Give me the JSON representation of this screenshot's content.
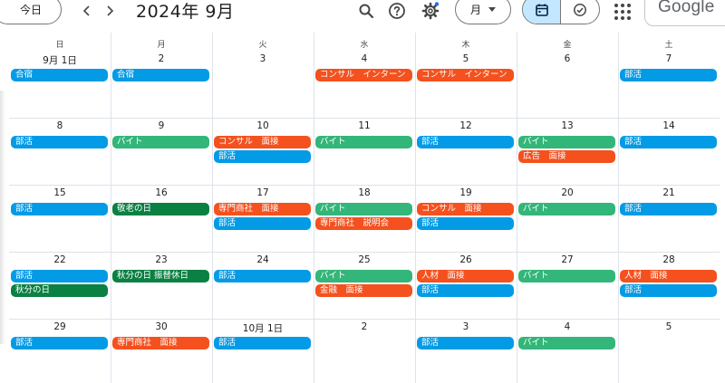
{
  "header": {
    "today_label": "今日",
    "month_title": "2024年 9月",
    "view_label": "月",
    "logo_text": "Google"
  },
  "colors": {
    "blue": "#039be5",
    "green": "#33b679",
    "dark_green": "#0b8043",
    "orange": "#f4511e",
    "selected_segment": "#c2e7ff",
    "notification_dot": "#1a73e8"
  },
  "icons": [
    "chevron-left-icon",
    "chevron-right-icon",
    "search-icon",
    "help-icon",
    "gear-icon",
    "calendar-icon",
    "task-check-icon",
    "apps-grid-icon"
  ],
  "weekdays": [
    "日",
    "月",
    "火",
    "水",
    "木",
    "金",
    "土"
  ],
  "weeks": [
    {
      "dates": [
        "9月 1日",
        "2",
        "3",
        "4",
        "5",
        "6",
        "7"
      ],
      "events": [
        {
          "day": 0,
          "row": 0,
          "text": "合宿",
          "color": "blue"
        },
        {
          "day": 1,
          "row": 0,
          "text": "合宿",
          "color": "blue"
        },
        {
          "day": 3,
          "row": 0,
          "text": "コンサル　インターン",
          "color": "orange"
        },
        {
          "day": 4,
          "row": 0,
          "text": "コンサル　インターン",
          "color": "orange"
        },
        {
          "day": 6,
          "row": 0,
          "text": "部活",
          "color": "blue"
        }
      ]
    },
    {
      "dates": [
        "8",
        "9",
        "10",
        "11",
        "12",
        "13",
        "14"
      ],
      "events": [
        {
          "day": 0,
          "row": 0,
          "text": "部活",
          "color": "blue"
        },
        {
          "day": 1,
          "row": 0,
          "text": "バイト",
          "color": "green"
        },
        {
          "day": 2,
          "row": 0,
          "text": "コンサル　面接",
          "color": "orange"
        },
        {
          "day": 2,
          "row": 1,
          "text": "部活",
          "color": "blue"
        },
        {
          "day": 3,
          "row": 0,
          "text": "バイト",
          "color": "green"
        },
        {
          "day": 4,
          "row": 0,
          "text": "部活",
          "color": "blue"
        },
        {
          "day": 5,
          "row": 0,
          "text": "バイト",
          "color": "green"
        },
        {
          "day": 5,
          "row": 1,
          "text": "広告　面接",
          "color": "orange"
        },
        {
          "day": 6,
          "row": 0,
          "text": "部活",
          "color": "blue"
        }
      ]
    },
    {
      "dates": [
        "15",
        "16",
        "17",
        "18",
        "19",
        "20",
        "21"
      ],
      "events": [
        {
          "day": 0,
          "row": 0,
          "text": "部活",
          "color": "blue"
        },
        {
          "day": 1,
          "row": 0,
          "text": "敬老の日",
          "color": "dark_green"
        },
        {
          "day": 2,
          "row": 0,
          "text": "専門商社　面接",
          "color": "orange"
        },
        {
          "day": 2,
          "row": 1,
          "text": "部活",
          "color": "blue"
        },
        {
          "day": 3,
          "row": 0,
          "text": "バイト",
          "color": "green"
        },
        {
          "day": 3,
          "row": 1,
          "text": "専門商社　説明会",
          "color": "orange"
        },
        {
          "day": 4,
          "row": 0,
          "text": "コンサル　面接",
          "color": "orange"
        },
        {
          "day": 4,
          "row": 1,
          "text": "部活",
          "color": "blue"
        },
        {
          "day": 5,
          "row": 0,
          "text": "バイト",
          "color": "green"
        },
        {
          "day": 6,
          "row": 0,
          "text": "部活",
          "color": "blue"
        }
      ]
    },
    {
      "dates": [
        "22",
        "23",
        "24",
        "25",
        "26",
        "27",
        "28"
      ],
      "events": [
        {
          "day": 0,
          "row": 0,
          "text": "部活",
          "color": "blue"
        },
        {
          "day": 0,
          "row": 1,
          "text": "秋分の日",
          "color": "dark_green"
        },
        {
          "day": 1,
          "row": 0,
          "text": "秋分の日 振替休日",
          "color": "dark_green"
        },
        {
          "day": 2,
          "row": 0,
          "text": "部活",
          "color": "blue"
        },
        {
          "day": 3,
          "row": 0,
          "text": "バイト",
          "color": "green"
        },
        {
          "day": 3,
          "row": 1,
          "text": "金融　面接",
          "color": "orange"
        },
        {
          "day": 4,
          "row": 0,
          "text": "人材　面接",
          "color": "orange"
        },
        {
          "day": 4,
          "row": 1,
          "text": "部活",
          "color": "blue"
        },
        {
          "day": 5,
          "row": 0,
          "text": "バイト",
          "color": "green"
        },
        {
          "day": 6,
          "row": 0,
          "text": "人材　面接",
          "color": "orange"
        },
        {
          "day": 6,
          "row": 1,
          "text": "部活",
          "color": "blue"
        }
      ]
    },
    {
      "dates": [
        "29",
        "30",
        "10月 1日",
        "2",
        "3",
        "4",
        "5"
      ],
      "events": [
        {
          "day": 0,
          "row": 0,
          "text": "部活",
          "color": "blue"
        },
        {
          "day": 1,
          "row": 0,
          "text": "専門商社　面接",
          "color": "orange"
        },
        {
          "day": 2,
          "row": 0,
          "text": "部活",
          "color": "blue"
        },
        {
          "day": 4,
          "row": 0,
          "text": "部活",
          "color": "blue"
        },
        {
          "day": 5,
          "row": 0,
          "text": "バイト",
          "color": "green"
        }
      ]
    }
  ]
}
